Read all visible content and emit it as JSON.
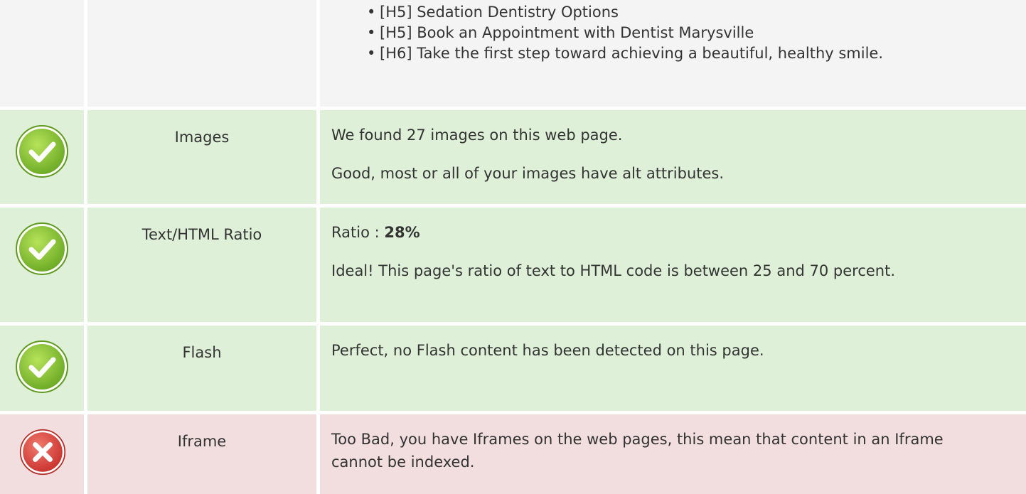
{
  "headings_row": {
    "items": [
      "[H5] Sedation Dentistry Options",
      "[H5] Book an Appointment with Dentist Marysville",
      "[H6] Take the first step toward achieving a beautiful, healthy smile."
    ]
  },
  "checks": [
    {
      "status": "pass",
      "icon": "check-circle-icon",
      "name": "Images",
      "line1": "We found 27 images on this web page.",
      "line2": "Good, most or all of your images have alt attributes."
    },
    {
      "status": "pass",
      "icon": "check-circle-icon",
      "name": "Text/HTML Ratio",
      "ratio_label": "Ratio : ",
      "ratio_value": "28%",
      "line2": "Ideal! This page's ratio of text to HTML code is between 25 and 70 percent."
    },
    {
      "status": "pass",
      "icon": "check-circle-icon",
      "name": "Flash",
      "line1": "Perfect, no Flash content has been detected on this page."
    },
    {
      "status": "fail",
      "icon": "error-circle-icon",
      "name": "Iframe",
      "line1": "Too Bad, you have Iframes on the web pages, this mean that content in an Iframe cannot be indexed."
    }
  ],
  "colors": {
    "pass_bg": "#dff0d8",
    "fail_bg": "#f2dede",
    "neutral_bg": "#f4f4f4",
    "pass_icon": "#8cc63f",
    "fail_icon": "#e0443f"
  }
}
